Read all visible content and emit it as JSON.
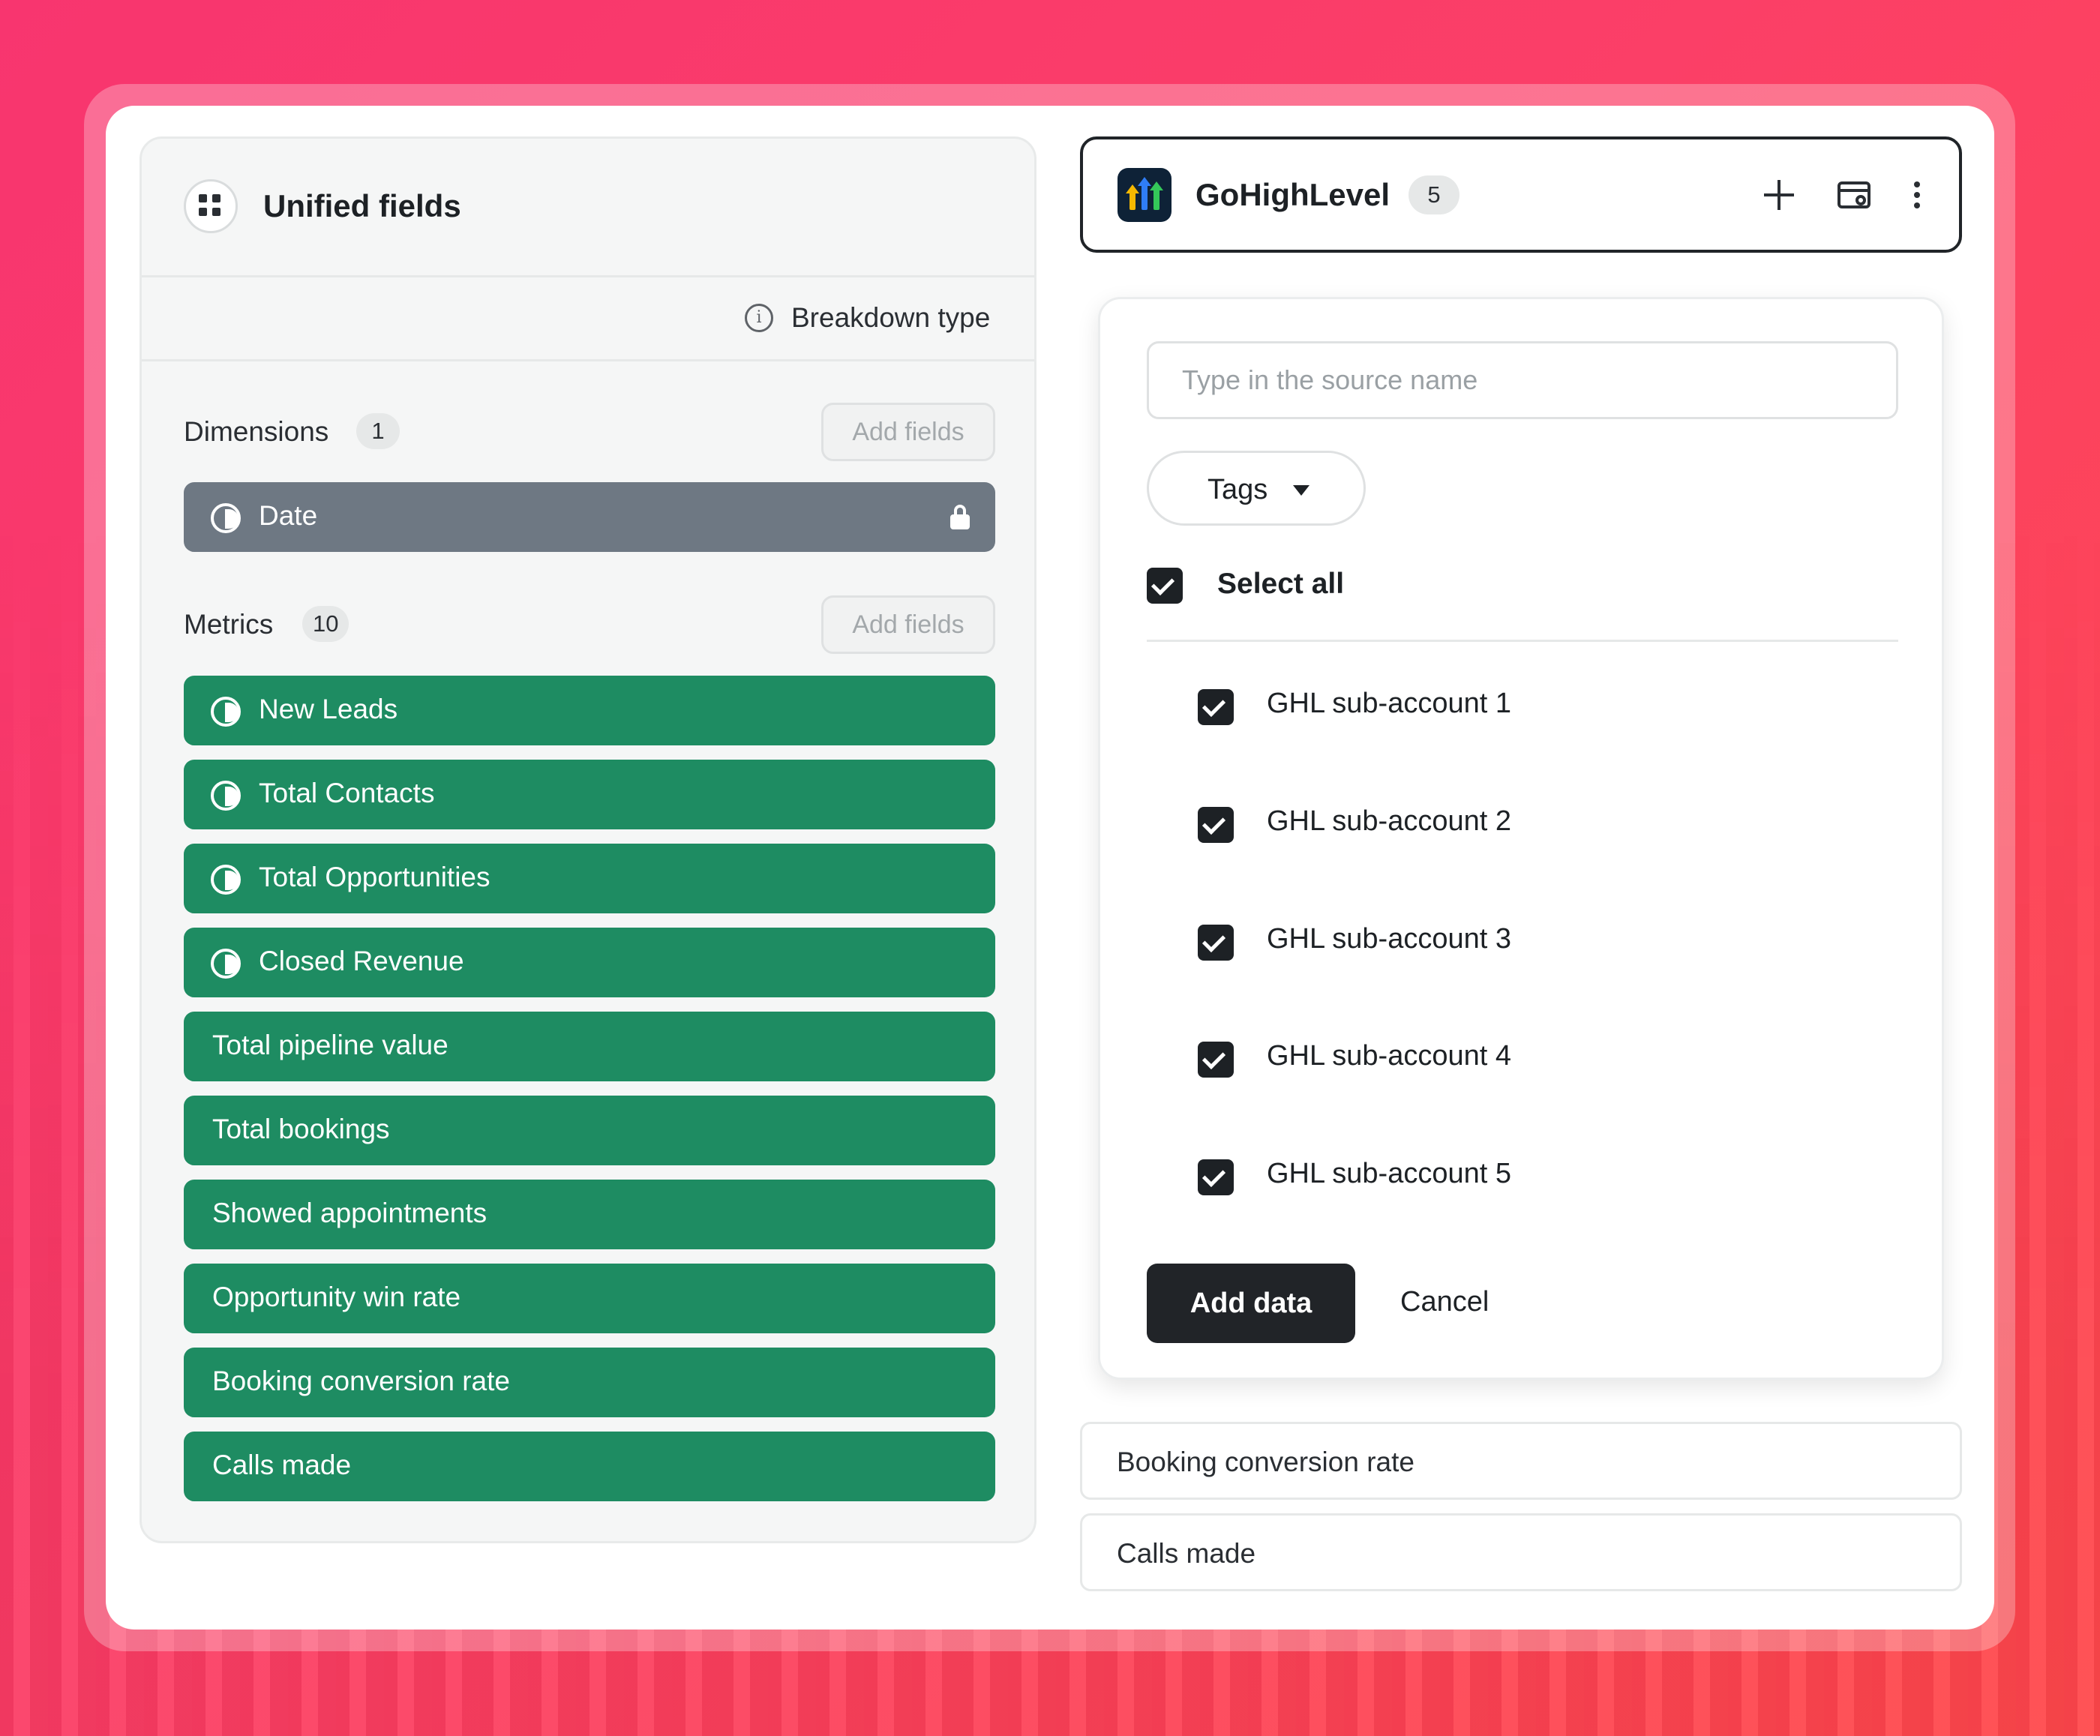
{
  "left_panel": {
    "title": "Unified fields",
    "breakdown_label": "Breakdown type",
    "info_icon": "info-icon",
    "dimensions": {
      "label": "Dimensions",
      "count": "1",
      "add_label": "Add fields",
      "items": [
        {
          "label": "Date",
          "locked": true,
          "color": "#6e7883"
        }
      ]
    },
    "metrics": {
      "label": "Metrics",
      "count": "10",
      "add_label": "Add fields",
      "items": [
        {
          "label": "New Leads",
          "icon": "pie-chart-icon"
        },
        {
          "label": "Total Contacts",
          "icon": "pie-chart-icon"
        },
        {
          "label": "Total Opportunities",
          "icon": "pie-chart-icon"
        },
        {
          "label": "Closed Revenue",
          "icon": "pie-chart-icon"
        },
        {
          "label": "Total pipeline value"
        },
        {
          "label": "Total bookings"
        },
        {
          "label": "Showed appointments"
        },
        {
          "label": "Opportunity win rate"
        },
        {
          "label": "Booking conversion rate"
        },
        {
          "label": "Calls made"
        }
      ],
      "color": "#1e8c62"
    }
  },
  "source": {
    "name": "GoHighLevel",
    "count": "5",
    "icons": [
      "plus-icon",
      "wallet-icon",
      "more-vertical-icon"
    ]
  },
  "popup": {
    "search_placeholder": "Type in the source name",
    "search_value": "",
    "tags_label": "Tags",
    "select_all_label": "Select all",
    "select_all_checked": true,
    "accounts": [
      {
        "label": "GHL sub-account 1",
        "checked": true
      },
      {
        "label": "GHL sub-account 2",
        "checked": true
      },
      {
        "label": "GHL sub-account 3",
        "checked": true
      },
      {
        "label": "GHL sub-account 4",
        "checked": true
      },
      {
        "label": "GHL sub-account 5",
        "checked": true
      }
    ],
    "add_button": "Add data",
    "cancel_button": "Cancel"
  },
  "below_rows": [
    {
      "label": "Booking conversion rate"
    },
    {
      "label": "Calls made"
    }
  ],
  "colors": {
    "accent_green": "#1e8c62",
    "dimension_gray": "#6e7883",
    "dark": "#212428"
  }
}
